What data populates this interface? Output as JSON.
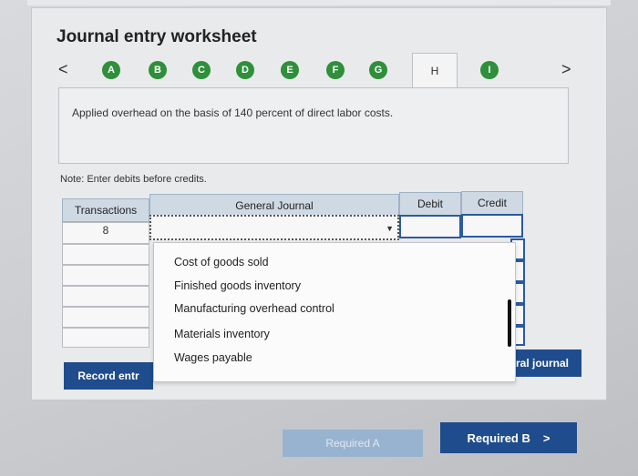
{
  "title": "Journal entry worksheet",
  "nav": {
    "prev": "<",
    "next": ">",
    "steps": [
      "A",
      "B",
      "C",
      "D",
      "E",
      "F",
      "G",
      "H",
      "I"
    ],
    "active_step": "H"
  },
  "description": "Applied overhead on the basis of 140 percent of direct labor costs.",
  "note": "Note: Enter debits before credits.",
  "table": {
    "headers": [
      "Transactions",
      "General Journal",
      "Debit",
      "Credit"
    ],
    "first_transaction": "8"
  },
  "dropdown": {
    "options": [
      "Cost of goods sold",
      "Finished goods inventory",
      "Manufacturing overhead control",
      "Materials inventory",
      "Wages payable"
    ]
  },
  "buttons": {
    "record": "Record entr",
    "view_journal": "ral journal",
    "required_a": "Required A",
    "required_b": "Required B",
    "required_b_arrow": ">"
  },
  "colors": {
    "step_green": "#2f8f3a",
    "button_blue": "#1f4c8c",
    "header_blue": "#cfd9e3"
  }
}
